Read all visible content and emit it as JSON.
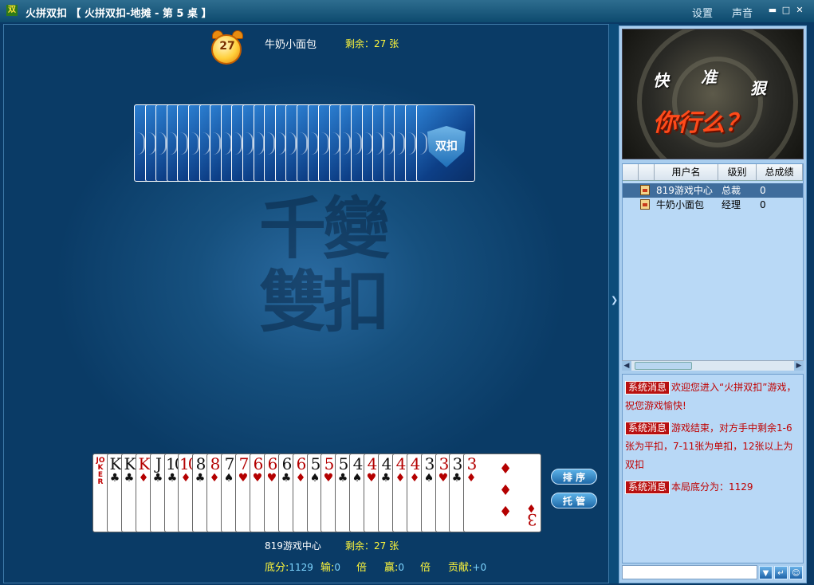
{
  "window": {
    "icon_text": "双",
    "title": "火拼双扣 【 火拼双扣-地摊 - 第 5 桌 】",
    "settings": "设置",
    "sound": "声音",
    "min_icon": "minimize-icon",
    "max_icon": "maximize-icon",
    "close_icon": "close-icon"
  },
  "table": {
    "watermark_line1": "千變",
    "watermark_line2": "雙扣",
    "timer": "27",
    "opponent": {
      "name": "牛奶小面包",
      "remaining": "剩余：27 张",
      "card_back_count": 27,
      "card_back_label": "双扣"
    },
    "player": {
      "name": "819游戏中心",
      "remaining": "剩余：27 张"
    },
    "buttons": {
      "sort": "排 序",
      "auto": "托 管"
    },
    "score": {
      "base_label": "底分:",
      "base_value": "1129",
      "lose_label": "输:",
      "lose_value": "0",
      "lose_unit": "倍",
      "win_label": "赢:",
      "win_value": "0",
      "win_unit": "倍",
      "contrib_label": "贡献:",
      "contrib_value": "+0"
    }
  },
  "hand": [
    {
      "rank": "JOKER",
      "suit": "",
      "color": "red",
      "joker": true
    },
    {
      "rank": "K",
      "suit": "♣",
      "color": "black"
    },
    {
      "rank": "K",
      "suit": "♣",
      "color": "black"
    },
    {
      "rank": "K",
      "suit": "♦",
      "color": "red"
    },
    {
      "rank": "J",
      "suit": "♣",
      "color": "black"
    },
    {
      "rank": "10",
      "suit": "♣",
      "color": "black"
    },
    {
      "rank": "10",
      "suit": "♦",
      "color": "red"
    },
    {
      "rank": "8",
      "suit": "♣",
      "color": "black"
    },
    {
      "rank": "8",
      "suit": "♦",
      "color": "red"
    },
    {
      "rank": "7",
      "suit": "♠",
      "color": "black"
    },
    {
      "rank": "7",
      "suit": "♥",
      "color": "red"
    },
    {
      "rank": "6",
      "suit": "♥",
      "color": "red"
    },
    {
      "rank": "6",
      "suit": "♥",
      "color": "red"
    },
    {
      "rank": "6",
      "suit": "♣",
      "color": "black"
    },
    {
      "rank": "6",
      "suit": "♦",
      "color": "red"
    },
    {
      "rank": "5",
      "suit": "♠",
      "color": "black"
    },
    {
      "rank": "5",
      "suit": "♥",
      "color": "red"
    },
    {
      "rank": "5",
      "suit": "♣",
      "color": "black"
    },
    {
      "rank": "4",
      "suit": "♠",
      "color": "black"
    },
    {
      "rank": "4",
      "suit": "♥",
      "color": "red"
    },
    {
      "rank": "4",
      "suit": "♣",
      "color": "black"
    },
    {
      "rank": "4",
      "suit": "♦",
      "color": "red"
    },
    {
      "rank": "4",
      "suit": "♦",
      "color": "red"
    },
    {
      "rank": "3",
      "suit": "♠",
      "color": "black"
    },
    {
      "rank": "3",
      "suit": "♥",
      "color": "red"
    },
    {
      "rank": "3",
      "suit": "♣",
      "color": "black"
    },
    {
      "rank": "3",
      "suit": "♦",
      "color": "red",
      "last": true
    }
  ],
  "banner": {
    "w1": "快",
    "w2": "准",
    "w3": "狠",
    "slogan": "你行么？"
  },
  "players_list": {
    "headers": [
      "",
      "",
      "用户名",
      "级别",
      "总成绩"
    ],
    "rows": [
      {
        "name": "819游戏中心",
        "level": "总裁",
        "score": "0",
        "selected": true
      },
      {
        "name": "牛奶小面包",
        "level": "经理",
        "score": "0",
        "selected": false
      }
    ]
  },
  "chat": {
    "messages": [
      {
        "tag": "系统消息",
        "text": "欢迎您进入“火拼双扣”游戏，祝您游戏愉快!"
      },
      {
        "tag": "系统消息",
        "text": "游戏结束，对方手中剩余1-6张为平扣，7-11张为单扣，12张以上为双扣"
      },
      {
        "tag": "系统消息",
        "text": "本局底分为：1129"
      }
    ],
    "input_value": ""
  },
  "colors": {
    "table_bg": "#0a3a66",
    "panel_bg": "#a9cdee",
    "accent_yellow": "#fff73a",
    "message_red": "#c00000"
  }
}
